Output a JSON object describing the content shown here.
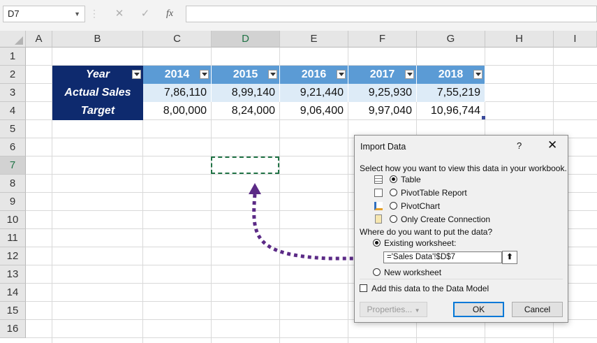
{
  "formula_bar": {
    "name_box": "D7",
    "cancel_glyph": "✕",
    "enter_glyph": "✓",
    "fx_label": "fx",
    "formula": ""
  },
  "columns": [
    "A",
    "B",
    "C",
    "D",
    "E",
    "F",
    "G",
    "H",
    "I"
  ],
  "rows": [
    "1",
    "2",
    "3",
    "4",
    "5",
    "6",
    "7",
    "8",
    "9",
    "10",
    "11",
    "12",
    "13",
    "14",
    "15",
    "16"
  ],
  "table": {
    "header": [
      "Year",
      "2014",
      "2015",
      "2016",
      "2017",
      "2018"
    ],
    "rows": [
      {
        "label": "Actual Sales",
        "values": [
          "7,86,110",
          "8,99,140",
          "9,21,440",
          "9,25,930",
          "7,55,219"
        ]
      },
      {
        "label": "Target",
        "values": [
          "8,00,000",
          "8,24,000",
          "9,06,400",
          "9,97,040",
          "10,96,744"
        ]
      }
    ]
  },
  "dialog": {
    "title": "Import Data",
    "help": "?",
    "close": "✕",
    "view_prompt": "Select how you want to view this data in your workbook.",
    "view_options": [
      {
        "label": "Table",
        "selected": true,
        "icon": "table-icon"
      },
      {
        "label": "PivotTable Report",
        "selected": false,
        "icon": "pivottable-icon"
      },
      {
        "label": "PivotChart",
        "selected": false,
        "icon": "pivotchart-icon"
      },
      {
        "label": "Only Create Connection",
        "selected": false,
        "icon": "connection-icon"
      }
    ],
    "put_prompt": "Where do you want to put the data?",
    "existing_label": "Existing worksheet:",
    "existing_value": "='Sales Data'!$D$7",
    "new_label": "New worksheet",
    "datamodel_label": "Add this data to the Data Model",
    "properties_label": "Properties...",
    "ok_label": "OK",
    "cancel_label": "Cancel"
  },
  "colors": {
    "header_dark": "#0e2a6e",
    "header_blue": "#5b9bd5",
    "row_light": "#ddebf7",
    "arrow": "#5b2a86",
    "selection": "#217346"
  }
}
